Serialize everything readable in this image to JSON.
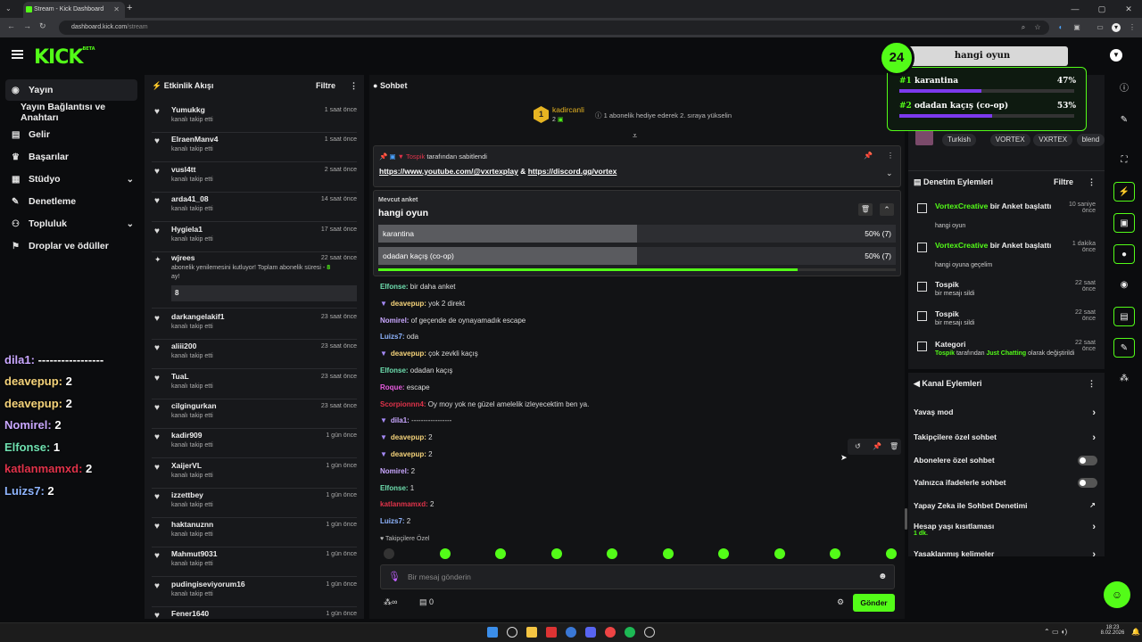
{
  "browser": {
    "tab_title": "Stream - Kick Dashboard",
    "tab_close": "✕",
    "newtab": "+",
    "url_host": "dashboard.kick.com",
    "url_path": "/stream",
    "win_min": "—",
    "win_max": "▢",
    "win_close": "✕"
  },
  "logo": {
    "text": "KICK",
    "beta": "BETA"
  },
  "sidebar": {
    "items": [
      {
        "label": "Yayın",
        "active": true
      },
      {
        "label": "Yayın Bağlantısı ve Anahtarı"
      },
      {
        "label": "Gelir"
      },
      {
        "label": "Başarılar"
      },
      {
        "label": "Stüdyo"
      },
      {
        "label": "Denetleme"
      },
      {
        "label": "Topluluk"
      },
      {
        "label": "Droplar ve ödüller"
      }
    ]
  },
  "overlay": [
    {
      "name": "dila1:",
      "text": " -----------------",
      "color": "#c9a7ff"
    },
    {
      "name": "deavepup:",
      "text": " 2",
      "color": "#f5d37a"
    },
    {
      "name": "deavepup:",
      "text": " 2",
      "color": "#f5d37a"
    },
    {
      "name": "Nomirel:",
      "text": " 2",
      "color": "#c9a7ff"
    },
    {
      "name": "Elfonse:",
      "text": " 1",
      "color": "#6fe0b0"
    },
    {
      "name": "katlanmamxd:",
      "text": " 2",
      "color": "#e0334a"
    },
    {
      "name": "Luizs7:",
      "text": " 2",
      "color": "#8fb5ff"
    }
  ],
  "activity": {
    "title": "Etkinlik Akışı",
    "filter": "Filtre",
    "items": [
      {
        "name": "Yumukkg",
        "sub": "kanalı takip etti",
        "time": "1 saat önce"
      },
      {
        "name": "ElraenManv4",
        "sub": "kanalı takip etti",
        "time": "1 saat önce"
      },
      {
        "name": "vusl4tt",
        "sub": "kanalı takip etti",
        "time": "2 saat önce"
      },
      {
        "name": "arda41_08",
        "sub": "kanalı takip etti",
        "time": "14 saat önce"
      },
      {
        "name": "Hygiela1",
        "sub": "kanalı takip etti",
        "time": "17 saat önce"
      }
    ],
    "resub": {
      "name": "wjrees",
      "time": "22 saat önce",
      "line1": "abonelik yenilemesini kutluyor! Toplam abonelik süresi - ",
      "months": "8",
      "line2": "ay!",
      "box": "8"
    },
    "items2": [
      {
        "name": "darkangelakif1",
        "sub": "kanalı takip etti",
        "time": "23 saat önce"
      },
      {
        "name": "aliii200",
        "sub": "kanalı takip etti",
        "time": "23 saat önce"
      },
      {
        "name": "TuaL",
        "sub": "kanalı takip etti",
        "time": "23 saat önce"
      },
      {
        "name": "cilgingurkan",
        "sub": "kanalı takip etti",
        "time": "23 saat önce"
      },
      {
        "name": "kadir909",
        "sub": "kanalı takip etti",
        "time": "1 gün önce"
      },
      {
        "name": "XaijerVL",
        "sub": "kanalı takip etti",
        "time": "1 gün önce"
      },
      {
        "name": "izzettbey",
        "sub": "kanalı takip etti",
        "time": "1 gün önce"
      },
      {
        "name": "haktanuznn",
        "sub": "kanalı takip etti",
        "time": "1 gün önce"
      },
      {
        "name": "Mahmut9031",
        "sub": "kanalı takip etti",
        "time": "1 gün önce"
      },
      {
        "name": "pudingiseviyorum16",
        "sub": "kanalı takip etti",
        "time": "1 gün önce"
      },
      {
        "name": "Fener1640",
        "sub": "",
        "time": "1 gün önce"
      }
    ]
  },
  "chat": {
    "title": "Sohbet",
    "gifter": {
      "rank": "1",
      "name": "kadircanli",
      "count": "2",
      "text": "1 abonelik hediye ederek 2. sıraya yükselin"
    },
    "pinned": {
      "by": "Tospik",
      "suffix": " tarafından sabitlendi",
      "link1": "https://www.youtube.com/@vxrtexplay",
      "amp": " & ",
      "link2": "https://discord.gg/vortex"
    },
    "poll": {
      "label": "Mevcut anket",
      "question": "hangi oyun",
      "options": [
        {
          "name": "karantina",
          "result": "50% (7)",
          "pct": 0.5
        },
        {
          "name": "odadan kaçış (co-op)",
          "result": "50% (7)",
          "pct": 0.5
        }
      ]
    },
    "messages": [
      {
        "user": "Elfonse:",
        "text": " bir daha anket",
        "color": "#6fe0b0",
        "badge": ""
      },
      {
        "user": "deavepup:",
        "text": " yok 2 direkt",
        "color": "#f5d37a",
        "badge": "▼"
      },
      {
        "user": "Nomirel:",
        "text": " of geçende de oynayamadık escape",
        "color": "#c9a7ff",
        "badge": ""
      },
      {
        "user": "Luizs7:",
        "text": " oda",
        "color": "#8fb5ff",
        "badge": ""
      },
      {
        "user": "deavepup:",
        "text": " çok zevkli kaçış",
        "color": "#f5d37a",
        "badge": "▼"
      },
      {
        "user": "Elfonse:",
        "text": " odadan kaçış",
        "color": "#6fe0b0",
        "badge": ""
      },
      {
        "user": "Roque:",
        "text": " escape",
        "color": "#e85ce0",
        "badge": ""
      },
      {
        "user": "Scorpionnn4:",
        "text": " Oy moy yok ne güzel amelelik izleyecektim ben ya.",
        "color": "#e0334a",
        "badge": ""
      },
      {
        "user": "dila1:",
        "text": " -----------------",
        "color": "#c9a7ff",
        "badge": "▼"
      },
      {
        "user": "deavepup:",
        "text": " 2",
        "color": "#f5d37a",
        "badge": "▼"
      },
      {
        "user": "deavepup:",
        "text": " 2",
        "color": "#f5d37a",
        "badge": "▼"
      },
      {
        "user": "Nomirel:",
        "text": " 2",
        "color": "#c9a7ff",
        "badge": ""
      },
      {
        "user": "Elfonse:",
        "text": " 1",
        "color": "#6fe0b0",
        "badge": ""
      },
      {
        "user": "katlanmamxd:",
        "text": " 2",
        "color": "#e0334a",
        "badge": ""
      },
      {
        "user": "Luizs7:",
        "text": " 2",
        "color": "#8fb5ff",
        "badge": ""
      }
    ],
    "followers_only": "Takipçilere Özel",
    "input_placeholder": "Bir mesaj gönderin",
    "stats": {
      "infinity": "∞",
      "count": "0"
    },
    "send": "Gönder"
  },
  "poll_widget": {
    "timer": "24",
    "title": "hangi oyun",
    "options": [
      {
        "rank": "#1",
        "name": "karantina",
        "pct": "47%",
        "frac": 0.47
      },
      {
        "rank": "#2",
        "name": "odadan kaçış (co-op)",
        "pct": "53%",
        "frac": 0.53
      }
    ]
  },
  "tags": [
    "Turkish",
    "VORTEX",
    "VXRTEX",
    "blend"
  ],
  "moderation": {
    "title": "Denetim Eylemleri",
    "filter": "Filtre",
    "items": [
      {
        "user": "VortexCreative",
        "action": " bir Anket başlattı",
        "sub": "hangi oyun",
        "time": "10 saniye önce"
      },
      {
        "user": "VortexCreative",
        "action": " bir Anket başlattı",
        "sub": "hangi oyuna geçelim",
        "time": "1 dakika önce"
      },
      {
        "user": "Tospik",
        "action": "",
        "sub": "bir mesajı sildi",
        "time": "22 saat önce"
      },
      {
        "user": "Tospik",
        "action": "",
        "sub": "bir mesajı sildi",
        "time": "22 saat önce"
      },
      {
        "user": "Kategori",
        "action": "",
        "sub_user": "Tospik",
        "sub_mid": " tarafından ",
        "sub_cat": "Just Chatting",
        "sub_end": " olarak değiştirildi",
        "time": "22 saat önce"
      }
    ]
  },
  "channel": {
    "title": "Kanal Eylemleri",
    "items": [
      {
        "label": "Yavaş mod",
        "kind": "arrow"
      },
      {
        "label": "Takipçilere özel sohbet",
        "kind": "arrow"
      },
      {
        "label": "Abonelere özel sohbet",
        "kind": "toggle"
      },
      {
        "label": "Yalnızca ifadelerle sohbet",
        "kind": "toggle"
      },
      {
        "label": "Yapay Zeka ile Sohbet Denetimi",
        "kind": "ext"
      },
      {
        "label": "Hesap yaşı kısıtlaması",
        "sub": "1 dk.",
        "kind": "arrow"
      },
      {
        "label": "Yasaklanmış kelimeler",
        "kind": "arrow"
      }
    ]
  },
  "clock": {
    "time": "18:23",
    "date": "8.02.2026"
  },
  "colors": {
    "accent": "#53fc18"
  }
}
